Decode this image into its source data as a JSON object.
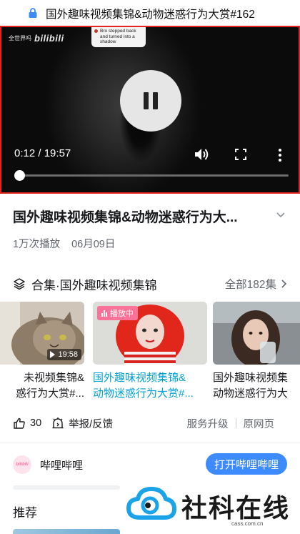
{
  "urlbar": {
    "icon": "lock-icon",
    "title": "国外趣味视频集锦&动物迷惑行为大赏#162"
  },
  "player": {
    "watermark_small": "全世界吗",
    "watermark_brand": "bilibili",
    "bubble_text": "Bro stepped back and turned into a shadow",
    "current_time": "0:12",
    "separator": " / ",
    "duration": "19:57",
    "progress_fraction": 0.012,
    "state": "playing",
    "icons": [
      "pause-icon",
      "volume-icon",
      "fullscreen-icon",
      "more-vertical-icon"
    ]
  },
  "video": {
    "title": "国外趣味视频集锦&动物迷惑行为大...",
    "views": "1万次播放",
    "date": "06月09日"
  },
  "collection": {
    "label": "合集·国外趣味视频集锦",
    "all_label": "全部182集",
    "cards": [
      {
        "title_line1": "未视频集锦&",
        "title_line2": "惑行为大赏#...",
        "duration": "19:58",
        "active": false
      },
      {
        "title_line1": "国外趣味视频集锦&",
        "title_line2": "动物迷惑行为大赏#...",
        "badge": "播放中",
        "active": true
      },
      {
        "title_line1": "国外趣味视频集",
        "title_line2": "动物迷惑行为大",
        "active": false
      }
    ]
  },
  "actions": {
    "like_count": "30",
    "report_label": "举报/反馈",
    "upgrade_label": "服务升级",
    "original_label": "原网页"
  },
  "bili": {
    "logo_text": "bilibili",
    "name": "哔哩哔哩",
    "open_label": "打开哔哩哔哩"
  },
  "recommend": {
    "label": "推荐"
  },
  "watermark": {
    "text": "社科在线",
    "url": "cass.com.cn"
  },
  "colors": {
    "accent_blue": "#3e8bff",
    "active_title": "#00a1d6",
    "player_border": "#e5231f",
    "badge_pink": "#fb7299"
  }
}
